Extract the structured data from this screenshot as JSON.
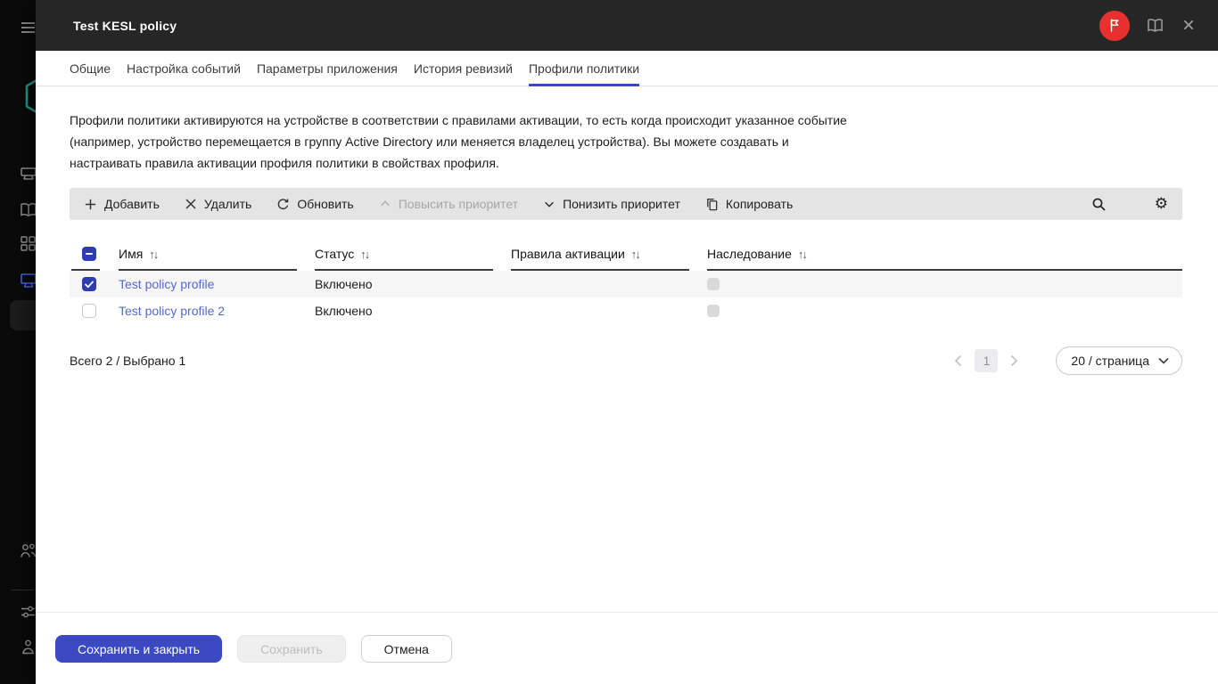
{
  "window": {
    "title": "Test KESL policy"
  },
  "sidebar": {
    "icons": [
      "menu-icon",
      "kaspersky-logo",
      "devices-icon",
      "reports-icon",
      "apps-grid-icon",
      "monitor-icon",
      "users-icon",
      "sliders-icon",
      "account-icon"
    ]
  },
  "header_icons": [
    "flag-icon",
    "help-book-icon",
    "close-icon"
  ],
  "tabs": [
    {
      "label": "Общие",
      "active": false
    },
    {
      "label": "Настройка событий",
      "active": false
    },
    {
      "label": "Параметры приложения",
      "active": false
    },
    {
      "label": "История ревизий",
      "active": false
    },
    {
      "label": "Профили политики",
      "active": true
    }
  ],
  "description": "Профили политики активируются на устройстве в соответствии с правилами активации, то есть когда происходит указанное событие (например, устройство перемещается в группу Active Directory или меняется владелец устройства). Вы можете создавать и настраивать правила активации профиля политики в свойствах профиля.",
  "toolbar": {
    "buttons": [
      {
        "label": "Добавить",
        "icon": "plus-icon",
        "disabled": false
      },
      {
        "label": "Удалить",
        "icon": "x-icon",
        "disabled": false
      },
      {
        "label": "Обновить",
        "icon": "refresh-icon",
        "disabled": false
      },
      {
        "label": "Повысить приоритет",
        "icon": "chevron-up-icon",
        "disabled": true
      },
      {
        "label": "Понизить приоритет",
        "icon": "chevron-down-icon",
        "disabled": false
      },
      {
        "label": "Копировать",
        "icon": "copy-icon",
        "disabled": false
      }
    ],
    "right_icons": [
      "search-icon",
      "gear-icon"
    ]
  },
  "glyphs": {
    "gear": "⚙",
    "sort": "↑↓",
    "close": "×"
  },
  "table": {
    "header_checkbox_state": "indeterminate",
    "columns": [
      {
        "label": "Имя"
      },
      {
        "label": "Статус"
      },
      {
        "label": "Правила активации"
      },
      {
        "label": "Наследование"
      }
    ],
    "rows": [
      {
        "name": "Test policy profile",
        "status": "Включено",
        "activation_rules": "",
        "inheritance_enabled": false,
        "checked": true
      },
      {
        "name": "Test policy profile 2",
        "status": "Включено",
        "activation_rules": "",
        "inheritance_enabled": false,
        "checked": false
      }
    ]
  },
  "pagination": {
    "summary": "Всего 2 / Выбрано 1",
    "current_page": "1",
    "page_size_label": "20 / страница"
  },
  "actions": {
    "save_close_label": "Сохранить и закрыть",
    "save_label": "Сохранить",
    "cancel_label": "Отмена"
  },
  "colors": {
    "accent": "#3b49c3",
    "checkbox": "#2f3db2",
    "link": "#5468d4",
    "badge_red": "#e8312e",
    "titlebar_bg": "#262626",
    "toolbar_bg": "#e4e4e4",
    "selected_row_bg": "#f6f6f6"
  }
}
